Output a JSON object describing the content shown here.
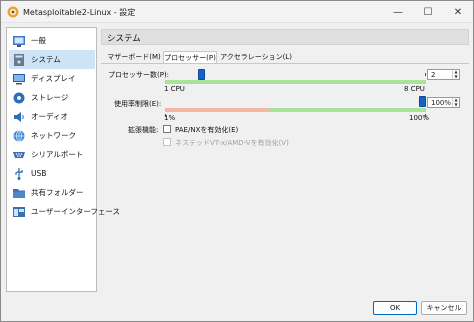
{
  "window": {
    "title": "Metasploitable2-Linux - 設定",
    "minimize_glyph": "—",
    "maximize_glyph": "☐",
    "close_glyph": "✕"
  },
  "sidebar": {
    "items": [
      {
        "label": "一般",
        "icon": "general-icon"
      },
      {
        "label": "システム",
        "icon": "system-icon",
        "selected": true
      },
      {
        "label": "ディスプレイ",
        "icon": "display-icon"
      },
      {
        "label": "ストレージ",
        "icon": "storage-icon"
      },
      {
        "label": "オーディオ",
        "icon": "audio-icon"
      },
      {
        "label": "ネットワーク",
        "icon": "network-icon"
      },
      {
        "label": "シリアルポート",
        "icon": "serial-port-icon"
      },
      {
        "label": "USB",
        "icon": "usb-icon"
      },
      {
        "label": "共有フォルダー",
        "icon": "shared-folder-icon"
      },
      {
        "label": "ユーザーインターフェース",
        "icon": "user-interface-icon"
      }
    ]
  },
  "panel": {
    "title": "システム",
    "tabs": [
      {
        "label": "マザーボード(M)"
      },
      {
        "label": "プロセッサー(P)",
        "active": true
      },
      {
        "label": "アクセラレーション(L)"
      }
    ]
  },
  "processor": {
    "label": "プロセッサー数(P):",
    "value": "2",
    "fraction": 0.14,
    "min_label": "1 CPU",
    "max_label": "8 CPU"
  },
  "exec_cap": {
    "label": "使用率制限(E):",
    "value": "100%",
    "fraction": 1.0,
    "min_label": "1%",
    "max_label": "100%"
  },
  "extended": {
    "label": "拡張機能:",
    "pae_label": "PAE/NXを有効化(E)",
    "nested_label": "ネステッドVT-x/AMD-Vを有効化(V)"
  },
  "footer": {
    "ok_label": "OK",
    "cancel_label": "キャンセル"
  },
  "colors": {
    "selection": "#cde4f6",
    "slider_thumb": "#1565c0",
    "track_green": "#a9e39b",
    "track_red": "#f2b8a2"
  }
}
